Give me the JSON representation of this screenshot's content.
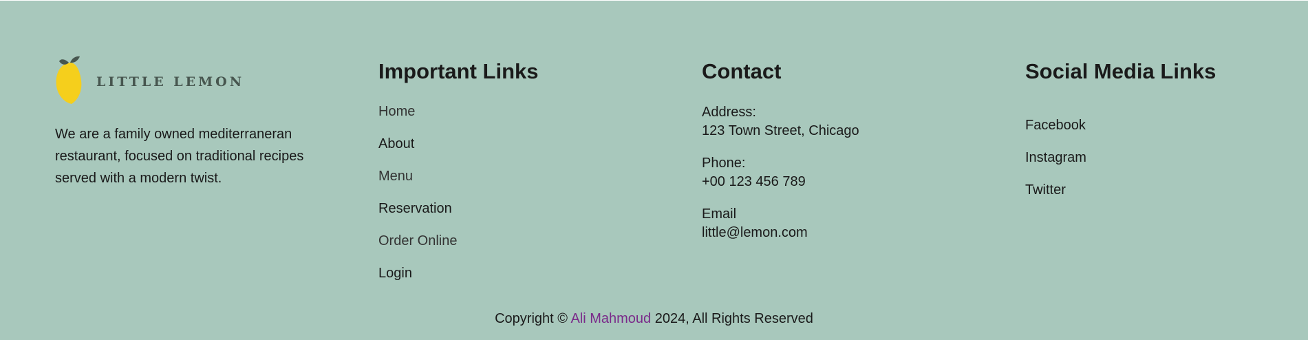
{
  "brand": {
    "logo_text": "LITTLE LEMON",
    "description": "We are a family owned mediterraneran restaurant, focused on traditional recipes served with a modern twist."
  },
  "important_links": {
    "heading": "Important Links",
    "items": [
      "Home",
      "About",
      "Menu",
      "Reservation",
      "Order Online",
      "Login"
    ]
  },
  "contact": {
    "heading": "Contact",
    "address_label": "Address:",
    "address": "123 Town Street, Chicago",
    "phone_label": "Phone:",
    "phone": "+00 123 456 789",
    "email_label": "Email",
    "email": "little@lemon.com"
  },
  "social": {
    "heading": "Social Media Links",
    "items": [
      "Facebook",
      "Instagram",
      "Twitter"
    ]
  },
  "copyright": {
    "prefix": "Copyright ©",
    "author": "Ali Mahmoud",
    "suffix": "2024, All Rights Reserved"
  },
  "colors": {
    "footer_background": "#a8c8bc",
    "author_link": "#7a2a8a",
    "lemon": "#f5cf1c",
    "leaf": "#47564f"
  }
}
